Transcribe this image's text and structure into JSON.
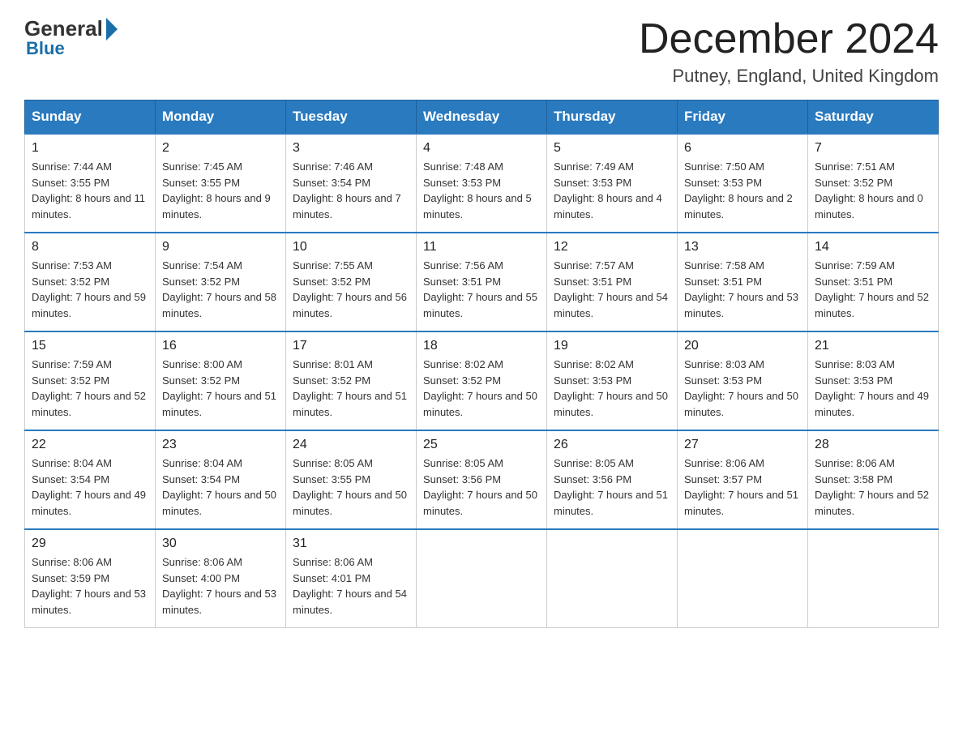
{
  "header": {
    "logo_general": "General",
    "logo_blue": "Blue",
    "month_title": "December 2024",
    "location": "Putney, England, United Kingdom"
  },
  "days_of_week": [
    "Sunday",
    "Monday",
    "Tuesday",
    "Wednesday",
    "Thursday",
    "Friday",
    "Saturday"
  ],
  "weeks": [
    [
      {
        "day": "1",
        "sunrise": "7:44 AM",
        "sunset": "3:55 PM",
        "daylight": "8 hours and 11 minutes."
      },
      {
        "day": "2",
        "sunrise": "7:45 AM",
        "sunset": "3:55 PM",
        "daylight": "8 hours and 9 minutes."
      },
      {
        "day": "3",
        "sunrise": "7:46 AM",
        "sunset": "3:54 PM",
        "daylight": "8 hours and 7 minutes."
      },
      {
        "day": "4",
        "sunrise": "7:48 AM",
        "sunset": "3:53 PM",
        "daylight": "8 hours and 5 minutes."
      },
      {
        "day": "5",
        "sunrise": "7:49 AM",
        "sunset": "3:53 PM",
        "daylight": "8 hours and 4 minutes."
      },
      {
        "day": "6",
        "sunrise": "7:50 AM",
        "sunset": "3:53 PM",
        "daylight": "8 hours and 2 minutes."
      },
      {
        "day": "7",
        "sunrise": "7:51 AM",
        "sunset": "3:52 PM",
        "daylight": "8 hours and 0 minutes."
      }
    ],
    [
      {
        "day": "8",
        "sunrise": "7:53 AM",
        "sunset": "3:52 PM",
        "daylight": "7 hours and 59 minutes."
      },
      {
        "day": "9",
        "sunrise": "7:54 AM",
        "sunset": "3:52 PM",
        "daylight": "7 hours and 58 minutes."
      },
      {
        "day": "10",
        "sunrise": "7:55 AM",
        "sunset": "3:52 PM",
        "daylight": "7 hours and 56 minutes."
      },
      {
        "day": "11",
        "sunrise": "7:56 AM",
        "sunset": "3:51 PM",
        "daylight": "7 hours and 55 minutes."
      },
      {
        "day": "12",
        "sunrise": "7:57 AM",
        "sunset": "3:51 PM",
        "daylight": "7 hours and 54 minutes."
      },
      {
        "day": "13",
        "sunrise": "7:58 AM",
        "sunset": "3:51 PM",
        "daylight": "7 hours and 53 minutes."
      },
      {
        "day": "14",
        "sunrise": "7:59 AM",
        "sunset": "3:51 PM",
        "daylight": "7 hours and 52 minutes."
      }
    ],
    [
      {
        "day": "15",
        "sunrise": "7:59 AM",
        "sunset": "3:52 PM",
        "daylight": "7 hours and 52 minutes."
      },
      {
        "day": "16",
        "sunrise": "8:00 AM",
        "sunset": "3:52 PM",
        "daylight": "7 hours and 51 minutes."
      },
      {
        "day": "17",
        "sunrise": "8:01 AM",
        "sunset": "3:52 PM",
        "daylight": "7 hours and 51 minutes."
      },
      {
        "day": "18",
        "sunrise": "8:02 AM",
        "sunset": "3:52 PM",
        "daylight": "7 hours and 50 minutes."
      },
      {
        "day": "19",
        "sunrise": "8:02 AM",
        "sunset": "3:53 PM",
        "daylight": "7 hours and 50 minutes."
      },
      {
        "day": "20",
        "sunrise": "8:03 AM",
        "sunset": "3:53 PM",
        "daylight": "7 hours and 50 minutes."
      },
      {
        "day": "21",
        "sunrise": "8:03 AM",
        "sunset": "3:53 PM",
        "daylight": "7 hours and 49 minutes."
      }
    ],
    [
      {
        "day": "22",
        "sunrise": "8:04 AM",
        "sunset": "3:54 PM",
        "daylight": "7 hours and 49 minutes."
      },
      {
        "day": "23",
        "sunrise": "8:04 AM",
        "sunset": "3:54 PM",
        "daylight": "7 hours and 50 minutes."
      },
      {
        "day": "24",
        "sunrise": "8:05 AM",
        "sunset": "3:55 PM",
        "daylight": "7 hours and 50 minutes."
      },
      {
        "day": "25",
        "sunrise": "8:05 AM",
        "sunset": "3:56 PM",
        "daylight": "7 hours and 50 minutes."
      },
      {
        "day": "26",
        "sunrise": "8:05 AM",
        "sunset": "3:56 PM",
        "daylight": "7 hours and 51 minutes."
      },
      {
        "day": "27",
        "sunrise": "8:06 AM",
        "sunset": "3:57 PM",
        "daylight": "7 hours and 51 minutes."
      },
      {
        "day": "28",
        "sunrise": "8:06 AM",
        "sunset": "3:58 PM",
        "daylight": "7 hours and 52 minutes."
      }
    ],
    [
      {
        "day": "29",
        "sunrise": "8:06 AM",
        "sunset": "3:59 PM",
        "daylight": "7 hours and 53 minutes."
      },
      {
        "day": "30",
        "sunrise": "8:06 AM",
        "sunset": "4:00 PM",
        "daylight": "7 hours and 53 minutes."
      },
      {
        "day": "31",
        "sunrise": "8:06 AM",
        "sunset": "4:01 PM",
        "daylight": "7 hours and 54 minutes."
      },
      null,
      null,
      null,
      null
    ]
  ]
}
